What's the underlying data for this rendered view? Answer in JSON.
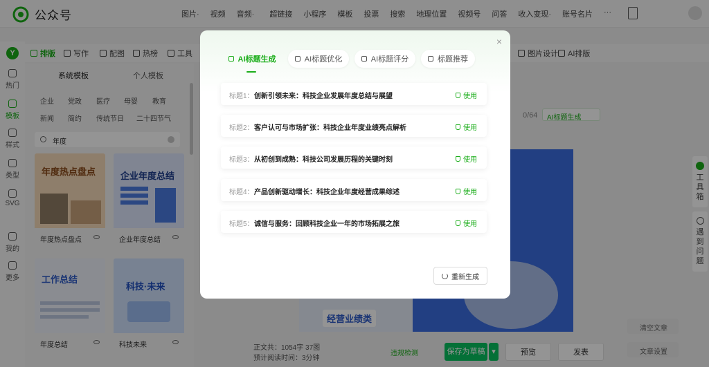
{
  "app": {
    "title": "公众号"
  },
  "topmenu": [
    "图片·",
    "视频",
    "音频·",
    "超链接",
    "小程序",
    "模板",
    "投票",
    "搜索",
    "地理位置",
    "视频号",
    "问答",
    "收入变现·",
    "账号名片",
    "···"
  ],
  "rail": [
    {
      "label": "热门"
    },
    {
      "label": "模板",
      "active": true
    },
    {
      "label": "样式"
    },
    {
      "label": "类型"
    },
    {
      "label": "SVG"
    },
    {
      "label": "我的"
    },
    {
      "label": "更多"
    }
  ],
  "toolrow": {
    "tabs": [
      "排版",
      "写作",
      "配图",
      "热榜",
      "工具"
    ],
    "right": [
      "图片设计",
      "AI排版"
    ]
  },
  "templates": {
    "tabs": [
      "系统模板",
      "个人模板"
    ],
    "categories": [
      "企业",
      "党政",
      "医疗",
      "母婴",
      "教育",
      "新闻",
      "简约",
      "传统节日",
      "二十四节气"
    ],
    "search_value": "年度",
    "cards": [
      {
        "label": "年度热点盘点",
        "title": "年度热点盘点",
        "color": "#e8a15a"
      },
      {
        "label": "企业年度总结",
        "title": "企业年度总结",
        "color": "#4a7be0"
      },
      {
        "label": "年度总结",
        "title": "工作总结",
        "color": "#4f8ee6"
      },
      {
        "label": "科技未来",
        "title": "科技·未来",
        "color": "#3f7fe8"
      }
    ]
  },
  "editor": {
    "counter": "0/64",
    "ai_title_button": "AI标题生成",
    "cover_caption": "经营业绩类"
  },
  "right_tools": {
    "toolbox": "工具箱",
    "issues": "遇到问题",
    "clear_button": "清空文章",
    "settings_button": "文章设置"
  },
  "bottom": {
    "word_count": "正文共：1054字 37图",
    "read_time": "预计阅读时间：3分钟",
    "check_button": "违规检测",
    "save_button": "保存为草稿",
    "preview_button": "预览",
    "publish_button": "发表"
  },
  "modal": {
    "tabs": [
      "AI标题生成",
      "AI标题优化",
      "AI标题评分",
      "标题推荐"
    ],
    "titles": [
      {
        "prefix": "标题1：",
        "text": "创新引领未来：科技企业发展年度总结与展望"
      },
      {
        "prefix": "标题2：",
        "text": "客户认可与市场扩张：科技企业年度业绩亮点解析"
      },
      {
        "prefix": "标题3：",
        "text": "从初创到成熟：科技公司发展历程的关键时刻"
      },
      {
        "prefix": "标题4：",
        "text": "产品创新驱动增长：科技企业年度经营成果综述"
      },
      {
        "prefix": "标题5：",
        "text": "诚信与服务：回顾科技企业一年的市场拓展之旅"
      }
    ],
    "use_label": "使用",
    "regenerate_label": "重新生成",
    "close_label": "×"
  },
  "colors": {
    "accent": "#1aad19",
    "overlay": "rgba(0,0,0,0.42)"
  }
}
